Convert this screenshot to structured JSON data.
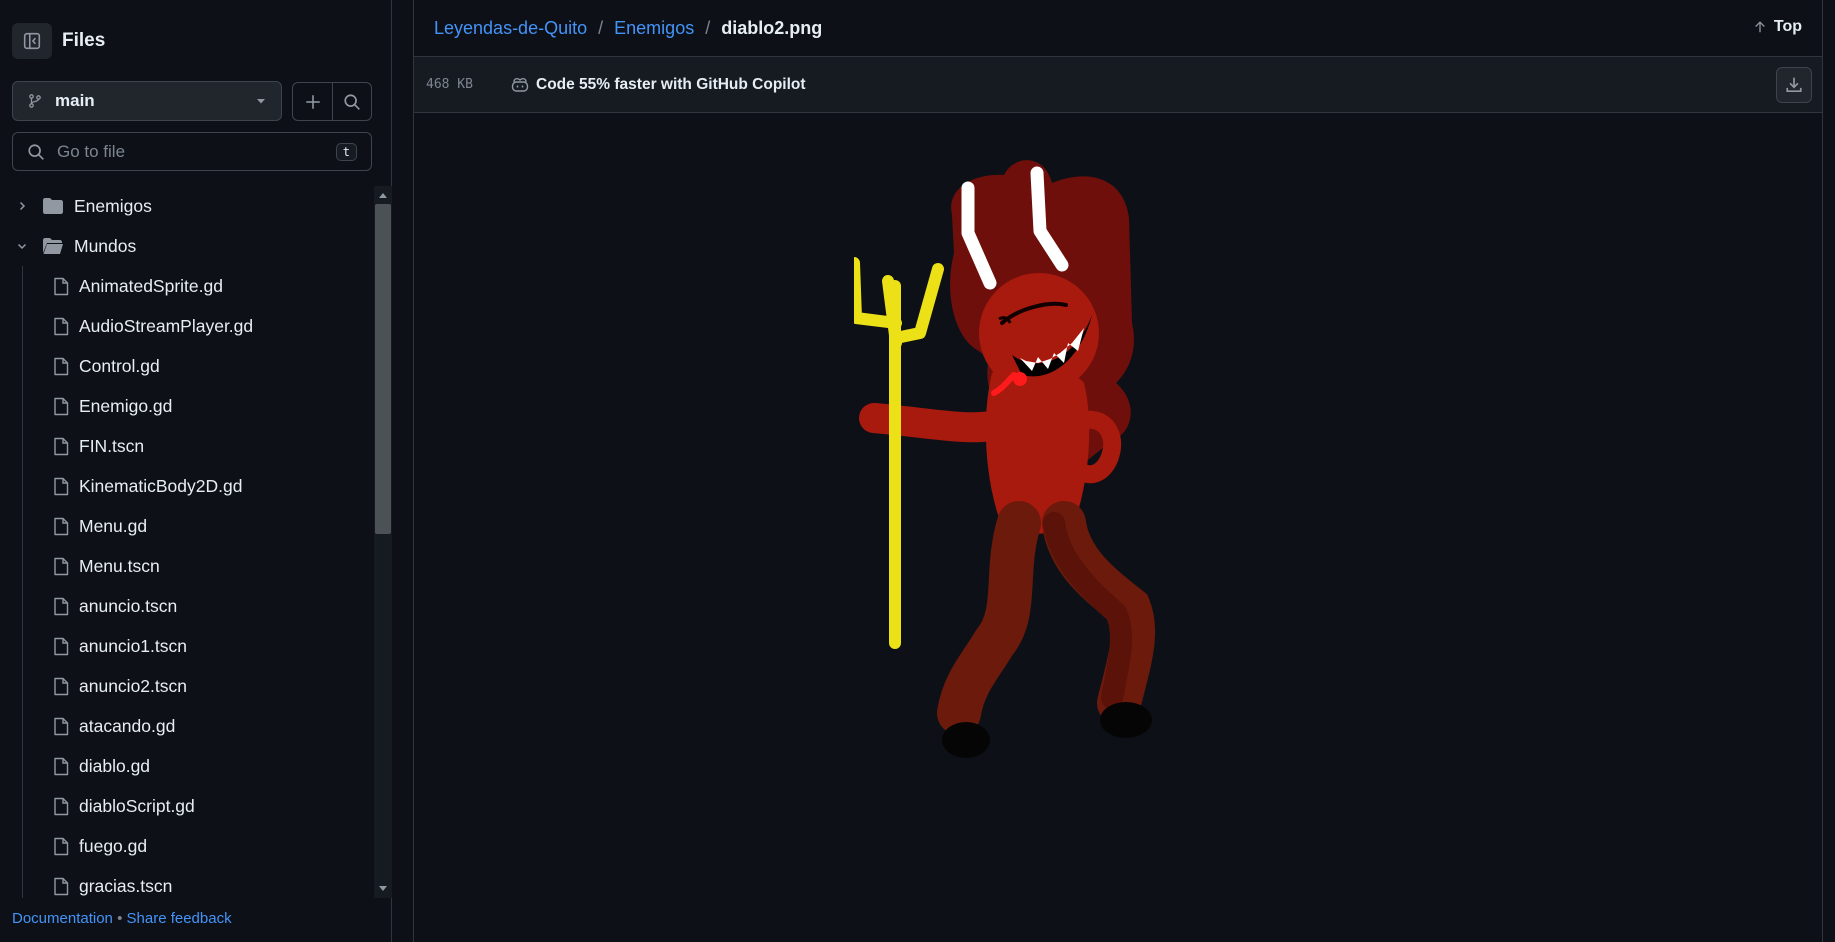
{
  "sidebar": {
    "title": "Files",
    "branch": "main",
    "search_placeholder": "Go to file",
    "search_shortcut": "t",
    "tree": [
      {
        "type": "folder",
        "name": "Enemigos",
        "expanded": false
      },
      {
        "type": "folder",
        "name": "Mundos",
        "expanded": true
      },
      {
        "type": "file",
        "name": "AnimatedSprite.gd"
      },
      {
        "type": "file",
        "name": "AudioStreamPlayer.gd"
      },
      {
        "type": "file",
        "name": "Control.gd"
      },
      {
        "type": "file",
        "name": "Enemigo.gd"
      },
      {
        "type": "file",
        "name": "FIN.tscn"
      },
      {
        "type": "file",
        "name": "KinematicBody2D.gd"
      },
      {
        "type": "file",
        "name": "Menu.gd"
      },
      {
        "type": "file",
        "name": "Menu.tscn"
      },
      {
        "type": "file",
        "name": "anuncio.tscn"
      },
      {
        "type": "file",
        "name": "anuncio1.tscn"
      },
      {
        "type": "file",
        "name": "anuncio2.tscn"
      },
      {
        "type": "file",
        "name": "atacando.gd"
      },
      {
        "type": "file",
        "name": "diablo.gd"
      },
      {
        "type": "file",
        "name": "diabloScript.gd"
      },
      {
        "type": "file",
        "name": "fuego.gd"
      },
      {
        "type": "file",
        "name": "gracias.tscn"
      }
    ],
    "footer": {
      "documentation": "Documentation",
      "separator": "•",
      "feedback": "Share feedback"
    }
  },
  "breadcrumb": {
    "repo": "Leyendas-de-Quito",
    "folder": "Enemigos",
    "separator": "/",
    "file": "diablo2.png"
  },
  "top_link": "Top",
  "file_info": {
    "size": "468 KB",
    "copilot_promo": "Code 55% faster with GitHub Copilot"
  },
  "colors": {
    "background": "#0d1117",
    "link": "#4493f8",
    "border": "#30363d"
  },
  "icons": {
    "sidebar_toggle": "sidebar-collapse-icon",
    "branch": "git-branch-icon",
    "add": "plus-icon",
    "search": "search-icon",
    "download": "download-icon",
    "copilot": "copilot-icon",
    "arrow_up": "arrow-up-icon"
  }
}
